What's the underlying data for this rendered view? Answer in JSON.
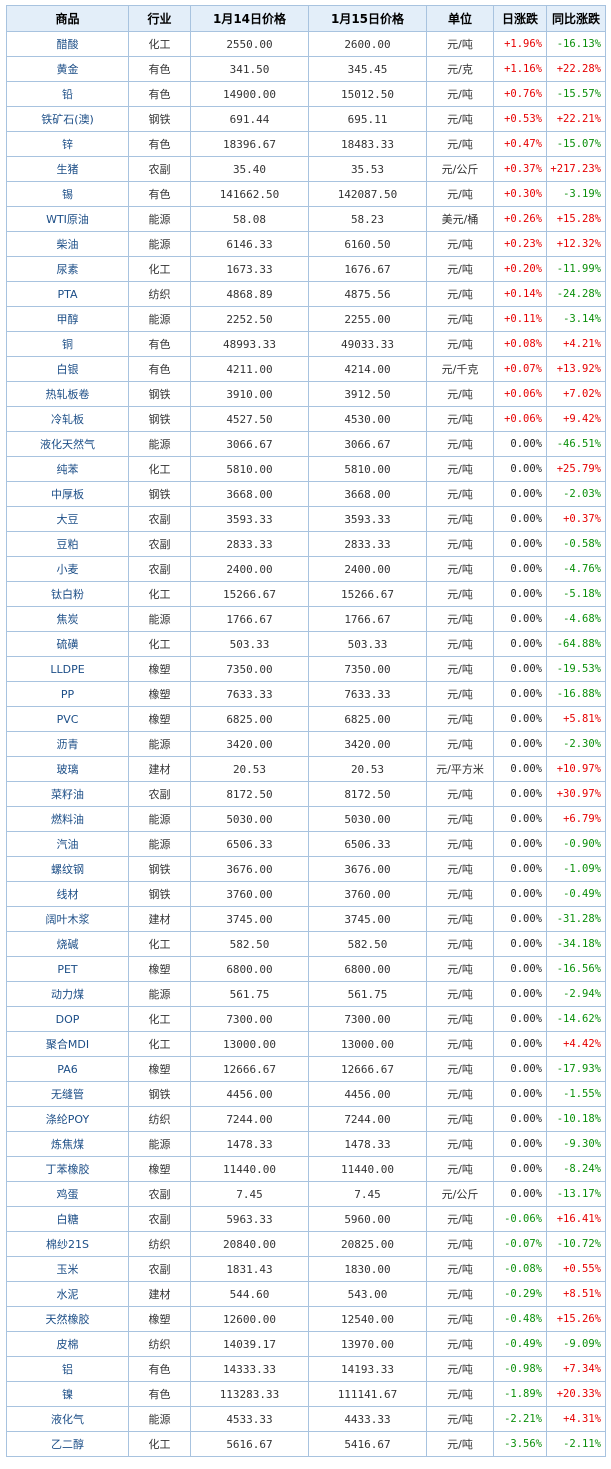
{
  "colors": {
    "up": "#e60000",
    "down": "#0a8f0a",
    "flat": "#222222",
    "header_bg": "#e3eef9",
    "border": "#a8c3df",
    "link": "#1c4e87"
  },
  "headers": [
    "商品",
    "行业",
    "1月14日价格",
    "1月15日价格",
    "单位",
    "日涨跌",
    "同比涨跌"
  ],
  "rows": [
    [
      "醋酸",
      "化工",
      "2550.00",
      "2600.00",
      "元/吨",
      "+1.96%",
      "-16.13%"
    ],
    [
      "黄金",
      "有色",
      "341.50",
      "345.45",
      "元/克",
      "+1.16%",
      "+22.28%"
    ],
    [
      "铅",
      "有色",
      "14900.00",
      "15012.50",
      "元/吨",
      "+0.76%",
      "-15.57%"
    ],
    [
      "铁矿石(澳)",
      "钢铁",
      "691.44",
      "695.11",
      "元/吨",
      "+0.53%",
      "+22.21%"
    ],
    [
      "锌",
      "有色",
      "18396.67",
      "18483.33",
      "元/吨",
      "+0.47%",
      "-15.07%"
    ],
    [
      "生猪",
      "农副",
      "35.40",
      "35.53",
      "元/公斤",
      "+0.37%",
      "+217.23%"
    ],
    [
      "锡",
      "有色",
      "141662.50",
      "142087.50",
      "元/吨",
      "+0.30%",
      "-3.19%"
    ],
    [
      "WTI原油",
      "能源",
      "58.08",
      "58.23",
      "美元/桶",
      "+0.26%",
      "+15.28%"
    ],
    [
      "柴油",
      "能源",
      "6146.33",
      "6160.50",
      "元/吨",
      "+0.23%",
      "+12.32%"
    ],
    [
      "尿素",
      "化工",
      "1673.33",
      "1676.67",
      "元/吨",
      "+0.20%",
      "-11.99%"
    ],
    [
      "PTA",
      "纺织",
      "4868.89",
      "4875.56",
      "元/吨",
      "+0.14%",
      "-24.28%"
    ],
    [
      "甲醇",
      "能源",
      "2252.50",
      "2255.00",
      "元/吨",
      "+0.11%",
      "-3.14%"
    ],
    [
      "铜",
      "有色",
      "48993.33",
      "49033.33",
      "元/吨",
      "+0.08%",
      "+4.21%"
    ],
    [
      "白银",
      "有色",
      "4211.00",
      "4214.00",
      "元/千克",
      "+0.07%",
      "+13.92%"
    ],
    [
      "热轧板卷",
      "钢铁",
      "3910.00",
      "3912.50",
      "元/吨",
      "+0.06%",
      "+7.02%"
    ],
    [
      "冷轧板",
      "钢铁",
      "4527.50",
      "4530.00",
      "元/吨",
      "+0.06%",
      "+9.42%"
    ],
    [
      "液化天然气",
      "能源",
      "3066.67",
      "3066.67",
      "元/吨",
      "0.00%",
      "-46.51%"
    ],
    [
      "纯苯",
      "化工",
      "5810.00",
      "5810.00",
      "元/吨",
      "0.00%",
      "+25.79%"
    ],
    [
      "中厚板",
      "钢铁",
      "3668.00",
      "3668.00",
      "元/吨",
      "0.00%",
      "-2.03%"
    ],
    [
      "大豆",
      "农副",
      "3593.33",
      "3593.33",
      "元/吨",
      "0.00%",
      "+0.37%"
    ],
    [
      "豆粕",
      "农副",
      "2833.33",
      "2833.33",
      "元/吨",
      "0.00%",
      "-0.58%"
    ],
    [
      "小麦",
      "农副",
      "2400.00",
      "2400.00",
      "元/吨",
      "0.00%",
      "-4.76%"
    ],
    [
      "钛白粉",
      "化工",
      "15266.67",
      "15266.67",
      "元/吨",
      "0.00%",
      "-5.18%"
    ],
    [
      "焦炭",
      "能源",
      "1766.67",
      "1766.67",
      "元/吨",
      "0.00%",
      "-4.68%"
    ],
    [
      "硫磺",
      "化工",
      "503.33",
      "503.33",
      "元/吨",
      "0.00%",
      "-64.88%"
    ],
    [
      "LLDPE",
      "橡塑",
      "7350.00",
      "7350.00",
      "元/吨",
      "0.00%",
      "-19.53%"
    ],
    [
      "PP",
      "橡塑",
      "7633.33",
      "7633.33",
      "元/吨",
      "0.00%",
      "-16.88%"
    ],
    [
      "PVC",
      "橡塑",
      "6825.00",
      "6825.00",
      "元/吨",
      "0.00%",
      "+5.81%"
    ],
    [
      "沥青",
      "能源",
      "3420.00",
      "3420.00",
      "元/吨",
      "0.00%",
      "-2.30%"
    ],
    [
      "玻璃",
      "建材",
      "20.53",
      "20.53",
      "元/平方米",
      "0.00%",
      "+10.97%"
    ],
    [
      "菜籽油",
      "农副",
      "8172.50",
      "8172.50",
      "元/吨",
      "0.00%",
      "+30.97%"
    ],
    [
      "燃料油",
      "能源",
      "5030.00",
      "5030.00",
      "元/吨",
      "0.00%",
      "+6.79%"
    ],
    [
      "汽油",
      "能源",
      "6506.33",
      "6506.33",
      "元/吨",
      "0.00%",
      "-0.90%"
    ],
    [
      "螺纹钢",
      "钢铁",
      "3676.00",
      "3676.00",
      "元/吨",
      "0.00%",
      "-1.09%"
    ],
    [
      "线材",
      "钢铁",
      "3760.00",
      "3760.00",
      "元/吨",
      "0.00%",
      "-0.49%"
    ],
    [
      "阔叶木浆",
      "建材",
      "3745.00",
      "3745.00",
      "元/吨",
      "0.00%",
      "-31.28%"
    ],
    [
      "烧碱",
      "化工",
      "582.50",
      "582.50",
      "元/吨",
      "0.00%",
      "-34.18%"
    ],
    [
      "PET",
      "橡塑",
      "6800.00",
      "6800.00",
      "元/吨",
      "0.00%",
      "-16.56%"
    ],
    [
      "动力煤",
      "能源",
      "561.75",
      "561.75",
      "元/吨",
      "0.00%",
      "-2.94%"
    ],
    [
      "DOP",
      "化工",
      "7300.00",
      "7300.00",
      "元/吨",
      "0.00%",
      "-14.62%"
    ],
    [
      "聚合MDI",
      "化工",
      "13000.00",
      "13000.00",
      "元/吨",
      "0.00%",
      "+4.42%"
    ],
    [
      "PA6",
      "橡塑",
      "12666.67",
      "12666.67",
      "元/吨",
      "0.00%",
      "-17.93%"
    ],
    [
      "无缝管",
      "钢铁",
      "4456.00",
      "4456.00",
      "元/吨",
      "0.00%",
      "-1.55%"
    ],
    [
      "涤纶POY",
      "纺织",
      "7244.00",
      "7244.00",
      "元/吨",
      "0.00%",
      "-10.18%"
    ],
    [
      "炼焦煤",
      "能源",
      "1478.33",
      "1478.33",
      "元/吨",
      "0.00%",
      "-9.30%"
    ],
    [
      "丁苯橡胶",
      "橡塑",
      "11440.00",
      "11440.00",
      "元/吨",
      "0.00%",
      "-8.24%"
    ],
    [
      "鸡蛋",
      "农副",
      "7.45",
      "7.45",
      "元/公斤",
      "0.00%",
      "-13.17%"
    ],
    [
      "白糖",
      "农副",
      "5963.33",
      "5960.00",
      "元/吨",
      "-0.06%",
      "+16.41%"
    ],
    [
      "棉纱21S",
      "纺织",
      "20840.00",
      "20825.00",
      "元/吨",
      "-0.07%",
      "-10.72%"
    ],
    [
      "玉米",
      "农副",
      "1831.43",
      "1830.00",
      "元/吨",
      "-0.08%",
      "+0.55%"
    ],
    [
      "水泥",
      "建材",
      "544.60",
      "543.00",
      "元/吨",
      "-0.29%",
      "+8.51%"
    ],
    [
      "天然橡胶",
      "橡塑",
      "12600.00",
      "12540.00",
      "元/吨",
      "-0.48%",
      "+15.26%"
    ],
    [
      "皮棉",
      "纺织",
      "14039.17",
      "13970.00",
      "元/吨",
      "-0.49%",
      "-9.09%"
    ],
    [
      "铝",
      "有色",
      "14333.33",
      "14193.33",
      "元/吨",
      "-0.98%",
      "+7.34%"
    ],
    [
      "镍",
      "有色",
      "113283.33",
      "111141.67",
      "元/吨",
      "-1.89%",
      "+20.33%"
    ],
    [
      "液化气",
      "能源",
      "4533.33",
      "4433.33",
      "元/吨",
      "-2.21%",
      "+4.31%"
    ],
    [
      "乙二醇",
      "化工",
      "5616.67",
      "5416.67",
      "元/吨",
      "-3.56%",
      "-2.11%"
    ]
  ]
}
